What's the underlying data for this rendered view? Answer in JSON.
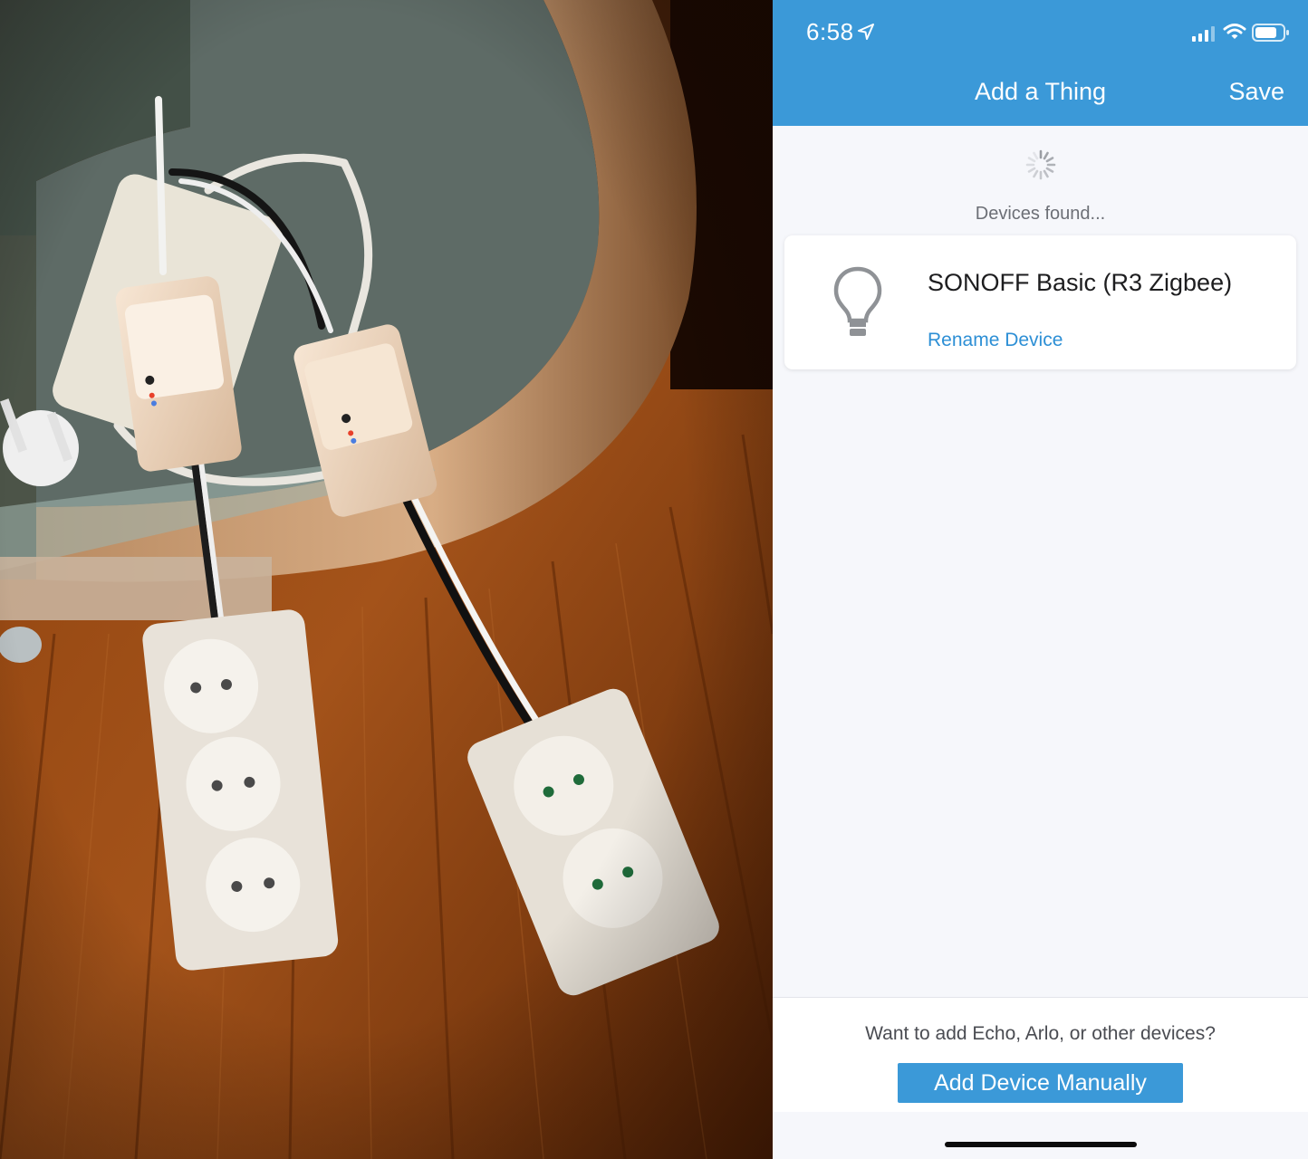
{
  "status_bar": {
    "time": "6:58",
    "location_icon": "location-arrow-icon",
    "signal_icon": "cellular-signal-icon",
    "wifi_icon": "wifi-icon",
    "battery_icon": "battery-icon"
  },
  "header": {
    "title": "Add a Thing",
    "save_label": "Save",
    "color": "#3b99d8"
  },
  "discovery": {
    "spinner_icon": "loading-spinner-icon",
    "status_text": "Devices found..."
  },
  "devices": [
    {
      "icon": "light-bulb-icon",
      "name": "SONOFF Basic (R3 Zigbee)",
      "rename_label": "Rename Device"
    }
  ],
  "footer": {
    "prompt": "Want to add Echo, Arlo, or other devices?",
    "add_manual_label": "Add Device Manually"
  },
  "colors": {
    "accent": "#3b99d8",
    "link": "#2d8fd5",
    "background": "#f6f7fb"
  }
}
